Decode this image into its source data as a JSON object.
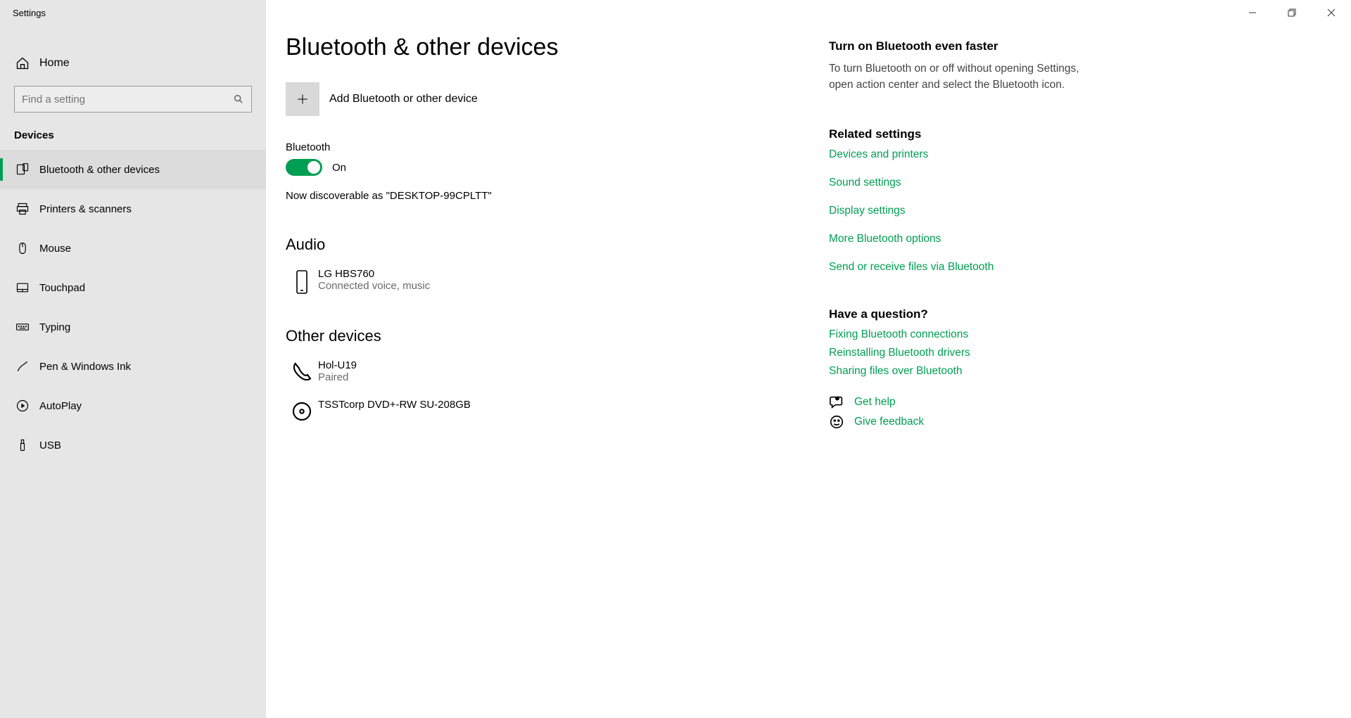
{
  "titlebar": {
    "title": "Settings"
  },
  "sidebar": {
    "home_label": "Home",
    "search_placeholder": "Find a setting",
    "section_label": "Devices",
    "items": [
      {
        "label": "Bluetooth & other devices"
      },
      {
        "label": "Printers & scanners"
      },
      {
        "label": "Mouse"
      },
      {
        "label": "Touchpad"
      },
      {
        "label": "Typing"
      },
      {
        "label": "Pen & Windows Ink"
      },
      {
        "label": "AutoPlay"
      },
      {
        "label": "USB"
      }
    ]
  },
  "page": {
    "title": "Bluetooth & other devices",
    "add_label": "Add Bluetooth or other device",
    "bluetooth_label": "Bluetooth",
    "bluetooth_state": "On",
    "discoverable_text": "Now discoverable as \"DESKTOP-99CPLTT\"",
    "audio_title": "Audio",
    "audio_devices": [
      {
        "name": "LG HBS760",
        "status": "Connected voice, music"
      }
    ],
    "other_title": "Other devices",
    "other_devices": [
      {
        "name": "Hol-U19",
        "status": "Paired"
      },
      {
        "name": "TSSTcorp DVD+-RW SU-208GB",
        "status": ""
      }
    ]
  },
  "aside": {
    "tip_title": "Turn on Bluetooth even faster",
    "tip_body": "To turn Bluetooth on or off without opening Settings, open action center and select the Bluetooth icon.",
    "related_title": "Related settings",
    "related_links": [
      "Devices and printers",
      "Sound settings",
      "Display settings",
      "More Bluetooth options",
      "Send or receive files via Bluetooth"
    ],
    "question_title": "Have a question?",
    "question_links": [
      "Fixing Bluetooth connections",
      "Reinstalling Bluetooth drivers",
      "Sharing files over Bluetooth"
    ],
    "get_help": "Get help",
    "give_feedback": "Give feedback"
  }
}
